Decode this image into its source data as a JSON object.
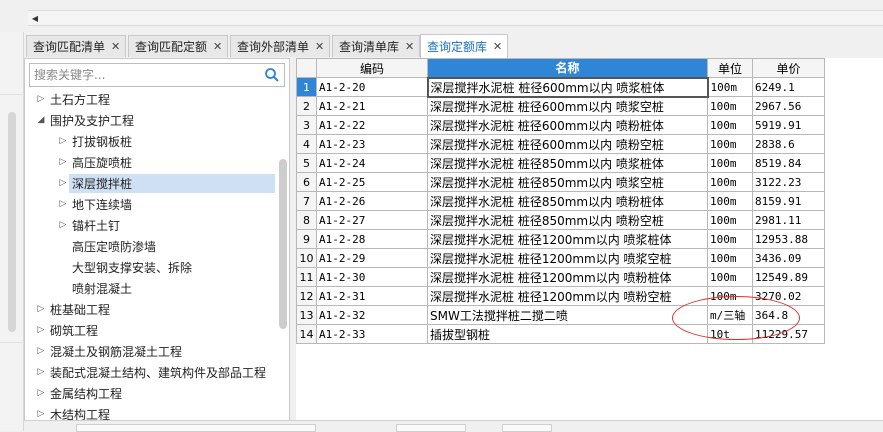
{
  "tabs": [
    {
      "label": "查询匹配清单",
      "active": false
    },
    {
      "label": "查询匹配定额",
      "active": false
    },
    {
      "label": "查询外部清单",
      "active": false
    },
    {
      "label": "查询清单库",
      "active": false
    },
    {
      "label": "查询定额库",
      "active": true
    }
  ],
  "tab_close_glyph": "✕",
  "search": {
    "placeholder": "搜索关键字..."
  },
  "tree": [
    {
      "label": "土石方工程",
      "level": 0,
      "state": "collapsed"
    },
    {
      "label": "围护及支护工程",
      "level": 0,
      "state": "expanded"
    },
    {
      "label": "打拔钢板桩",
      "level": 1,
      "state": "collapsed"
    },
    {
      "label": "高压旋喷桩",
      "level": 1,
      "state": "collapsed"
    },
    {
      "label": "深层搅拌桩",
      "level": 1,
      "state": "collapsed",
      "selected": true
    },
    {
      "label": "地下连续墙",
      "level": 1,
      "state": "collapsed"
    },
    {
      "label": "锚杆土钉",
      "level": 1,
      "state": "collapsed"
    },
    {
      "label": "高压定喷防渗墙",
      "level": 1,
      "state": "leaf"
    },
    {
      "label": "大型钢支撑安装、拆除",
      "level": 1,
      "state": "leaf"
    },
    {
      "label": "喷射混凝土",
      "level": 1,
      "state": "leaf"
    },
    {
      "label": "桩基础工程",
      "level": 0,
      "state": "collapsed"
    },
    {
      "label": "砌筑工程",
      "level": 0,
      "state": "collapsed"
    },
    {
      "label": "混凝土及钢筋混凝土工程",
      "level": 0,
      "state": "collapsed"
    },
    {
      "label": "装配式混凝土结构、建筑构件及部品工程",
      "level": 0,
      "state": "collapsed"
    },
    {
      "label": "金属结构工程",
      "level": 0,
      "state": "collapsed"
    },
    {
      "label": "木结构工程",
      "level": 0,
      "state": "collapsed"
    }
  ],
  "grid": {
    "headers": {
      "code": "编码",
      "name": "名称",
      "unit": "单位",
      "price": "单价"
    },
    "rows": [
      {
        "n": "1",
        "code": "A1-2-20",
        "name": "深层搅拌水泥桩 桩径600mm以内 喷浆桩体",
        "unit": "100m",
        "price": "6249.1"
      },
      {
        "n": "2",
        "code": "A1-2-21",
        "name": "深层搅拌水泥桩 桩径600mm以内 喷浆空桩",
        "unit": "100m",
        "price": "2967.56"
      },
      {
        "n": "3",
        "code": "A1-2-22",
        "name": "深层搅拌水泥桩 桩径600mm以内 喷粉桩体",
        "unit": "100m",
        "price": "5919.91"
      },
      {
        "n": "4",
        "code": "A1-2-23",
        "name": "深层搅拌水泥桩 桩径600mm以内 喷粉空桩",
        "unit": "100m",
        "price": "2838.6"
      },
      {
        "n": "5",
        "code": "A1-2-24",
        "name": "深层搅拌水泥桩 桩径850mm以内 喷浆桩体",
        "unit": "100m",
        "price": "8519.84"
      },
      {
        "n": "6",
        "code": "A1-2-25",
        "name": "深层搅拌水泥桩 桩径850mm以内 喷浆空桩",
        "unit": "100m",
        "price": "3122.23"
      },
      {
        "n": "7",
        "code": "A1-2-26",
        "name": "深层搅拌水泥桩 桩径850mm以内 喷粉桩体",
        "unit": "100m",
        "price": "8159.91"
      },
      {
        "n": "8",
        "code": "A1-2-27",
        "name": "深层搅拌水泥桩 桩径850mm以内 喷粉空桩",
        "unit": "100m",
        "price": "2981.11"
      },
      {
        "n": "9",
        "code": "A1-2-28",
        "name": "深层搅拌水泥桩 桩径1200mm以内 喷浆桩体",
        "unit": "100m",
        "price": "12953.88"
      },
      {
        "n": "10",
        "code": "A1-2-29",
        "name": "深层搅拌水泥桩 桩径1200mm以内 喷浆空桩",
        "unit": "100m",
        "price": "3436.09"
      },
      {
        "n": "11",
        "code": "A1-2-30",
        "name": "深层搅拌水泥桩 桩径1200mm以内 喷粉桩体",
        "unit": "100m",
        "price": "12549.89"
      },
      {
        "n": "12",
        "code": "A1-2-31",
        "name": "深层搅拌水泥桩 桩径1200mm以内 喷粉空桩",
        "unit": "100m",
        "price": "3270.02"
      },
      {
        "n": "13",
        "code": "A1-2-32",
        "name": "SMW工法搅拌桩二搅二喷",
        "unit": "m/三轴",
        "price": "364.8"
      },
      {
        "n": "14",
        "code": "A1-2-33",
        "name": "插拔型钢桩",
        "unit": "10t",
        "price": "11229.57"
      }
    ]
  },
  "colors": {
    "accent": "#2f86d6",
    "annotation": "#e03030",
    "selection": "#cfe0f4"
  }
}
